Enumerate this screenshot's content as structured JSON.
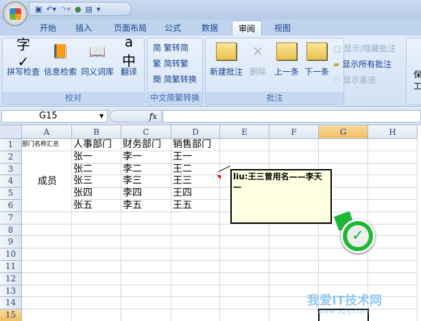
{
  "qat": {
    "icons": [
      "save-icon",
      "undo-icon",
      "redo-icon",
      "globe-icon",
      "form-icon",
      "customize-icon"
    ]
  },
  "tabs": [
    "开始",
    "插入",
    "页面布局",
    "公式",
    "数据",
    "审阅",
    "视图"
  ],
  "active_tab": "审阅",
  "ribbon": {
    "proofing": {
      "label": "校对",
      "buttons": [
        "拼写检查",
        "信息检索",
        "同义词库",
        "翻译"
      ]
    },
    "chinese": {
      "label": "中文简繁转换",
      "buttons": [
        "繁转简",
        "简转繁",
        "简繁转换"
      ]
    },
    "comments": {
      "label": "批注",
      "buttons": [
        "新建批注",
        "删除",
        "上一条",
        "下一条"
      ],
      "small": [
        "显示/隐藏批注",
        "显示所有批注",
        "显示墨迹"
      ]
    },
    "protect": {
      "partial": [
        "保",
        "工"
      ]
    }
  },
  "formula_bar": {
    "name_box": "G15",
    "fx": "fx",
    "value": ""
  },
  "sheet": {
    "columns": [
      "A",
      "B",
      "C",
      "D",
      "E",
      "F",
      "G",
      "H"
    ],
    "selected_col": "G",
    "selected_row": 15,
    "rows": [
      1,
      2,
      3,
      4,
      5,
      6,
      7,
      8,
      9,
      10,
      11,
      12,
      13,
      14,
      15
    ],
    "cells": {
      "A1": "部门名称汇总",
      "B1": "人事部门",
      "C1": "财务部门",
      "D1": "销售部门",
      "A2_6": "成员",
      "B2": "张一",
      "C2": "李一",
      "D2": "王一",
      "B3": "张二",
      "C3": "李二",
      "D3": "王二",
      "B4": "张三",
      "C4": "李三",
      "D4": "王三",
      "B5": "张四",
      "C5": "李四",
      "D5": "王四",
      "B6": "张五",
      "C6": "李五",
      "D6": "王五"
    }
  },
  "comment": {
    "text": "liu:王三曾用名——李天一"
  },
  "watermark": {
    "text": "我爱IT技术网",
    "url": "www.52ij.com"
  },
  "colors": {
    "accent": "#15428b",
    "selected_header": "#f1c15f",
    "check": "#1bb934"
  }
}
